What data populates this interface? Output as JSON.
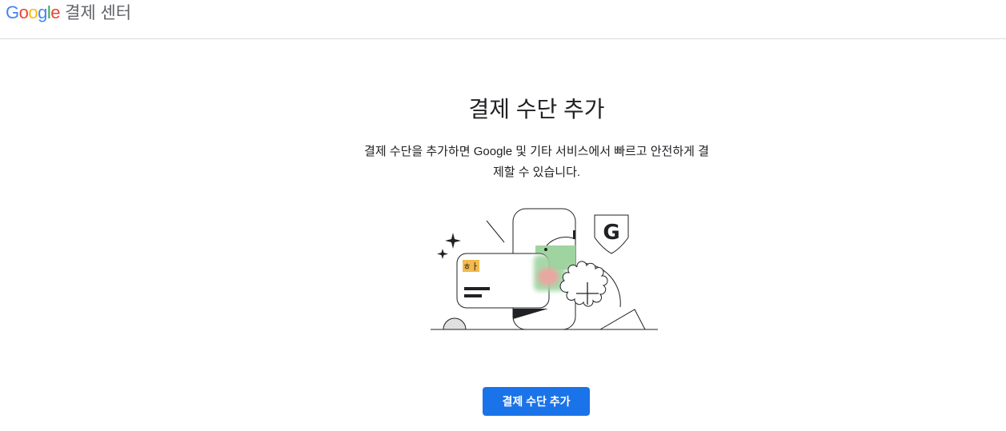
{
  "header": {
    "logo_letters": [
      "G",
      "o",
      "o",
      "g",
      "l",
      "e"
    ],
    "logo_colors": [
      "#4285F4",
      "#EA4335",
      "#FBBC05",
      "#4285F4",
      "#34A853",
      "#EA4335"
    ],
    "title": "결제 센터"
  },
  "main": {
    "title": "결제 수단 추가",
    "description": "결제 수단을 추가하면 Google 및 기타 서비스에서 빠르고 안전하게 결제할 수 있습니다.",
    "button_label": "결제 수단 추가",
    "illustration": {
      "chip_text": "ㅎㅏ",
      "accent_color": "#1a73e8",
      "card_green": "#9fd3a0",
      "blob_pink": "#e8a7a0",
      "chip_color": "#f2b94b",
      "icons": [
        "sparkle-icon",
        "credit-card-icon",
        "phone-icon",
        "google-shield-icon",
        "plus-badge-icon"
      ]
    }
  }
}
